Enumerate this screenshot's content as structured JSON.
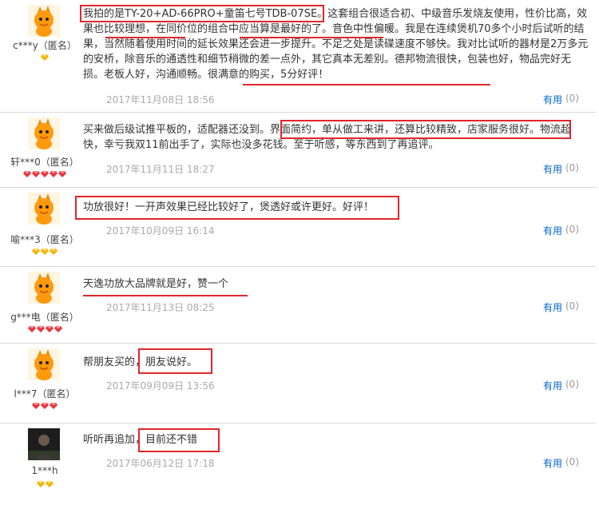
{
  "colors": {
    "annotation": "#e0262b",
    "link": "#0066cc",
    "date": "#aaaaaa"
  },
  "useful_label": "有用",
  "reviews": [
    {
      "user": "c***y（匿名）",
      "badge": "gold-diamond",
      "badge_count": 1,
      "avatar": "orange-mascot-avatar",
      "content": "我拍的是TY-20+AD-66PRO+童笛七号TDB-07SE。这套组合很适合初、中级音乐发烧友使用，性价比高，效果也比较理想，在同价位的组合中应当算是最好的了。音色中性偏暖。我是在连续煲机70多个小时后试听的结果，当然随着使用时间的延长效果还会进一步提升。不足之处是读碟速度不够快。我对比试听的器材是2万多元的安桥，除音乐的通透性和细节稍微的差一点外，其它真本无差别。德邦物流很快，包装也好，物品完好无损。老板人好，沟通顺畅。很满意的购买，5分好评！",
      "date": "2017年11月08日 18:56",
      "useful_count": "(0)"
    },
    {
      "user": "轩***0（匿名）",
      "badge": "red-diamond",
      "badge_count": 5,
      "avatar": "orange-mascot-avatar",
      "content": "买来做后级试推平板的，适配器还没到。界面简约，单从做工来讲，还算比较精致，店家服务很好。物流超快，幸亏我双11前出手了，实际也没多花钱。至于听感，等东西到了再追评。",
      "date": "2017年11月11日 18:27",
      "useful_count": "(0)"
    },
    {
      "user": "喻***3（匿名）",
      "badge": "gold-diamond",
      "badge_count": 3,
      "avatar": "orange-mascot-avatar",
      "content": "功放很好！一开声效果已经比较好了，煲透好或许更好。好评！",
      "date": "2017年10月09日 16:14",
      "useful_count": "(0)"
    },
    {
      "user": "g***电（匿名）",
      "badge": "red-diamond",
      "badge_count": 4,
      "avatar": "orange-mascot-avatar",
      "content": "天逸功放大品牌就是好，赞一个",
      "date": "2017年11月13日 08:25",
      "useful_count": "(0)"
    },
    {
      "user": "l***7（匿名）",
      "badge": "red-diamond",
      "badge_count": 3,
      "avatar": "orange-mascot-avatar",
      "content": "帮朋友买的，朋友说好。",
      "date": "2017年09月09日 13:56",
      "useful_count": "(0)"
    },
    {
      "user": "1***h",
      "badge": "gold-diamond",
      "badge_count": 2,
      "avatar": "photo-avatar",
      "content": "听听再追加，目前还不错",
      "date": "2017年06月12日 17:18",
      "useful_count": "(0)"
    }
  ]
}
